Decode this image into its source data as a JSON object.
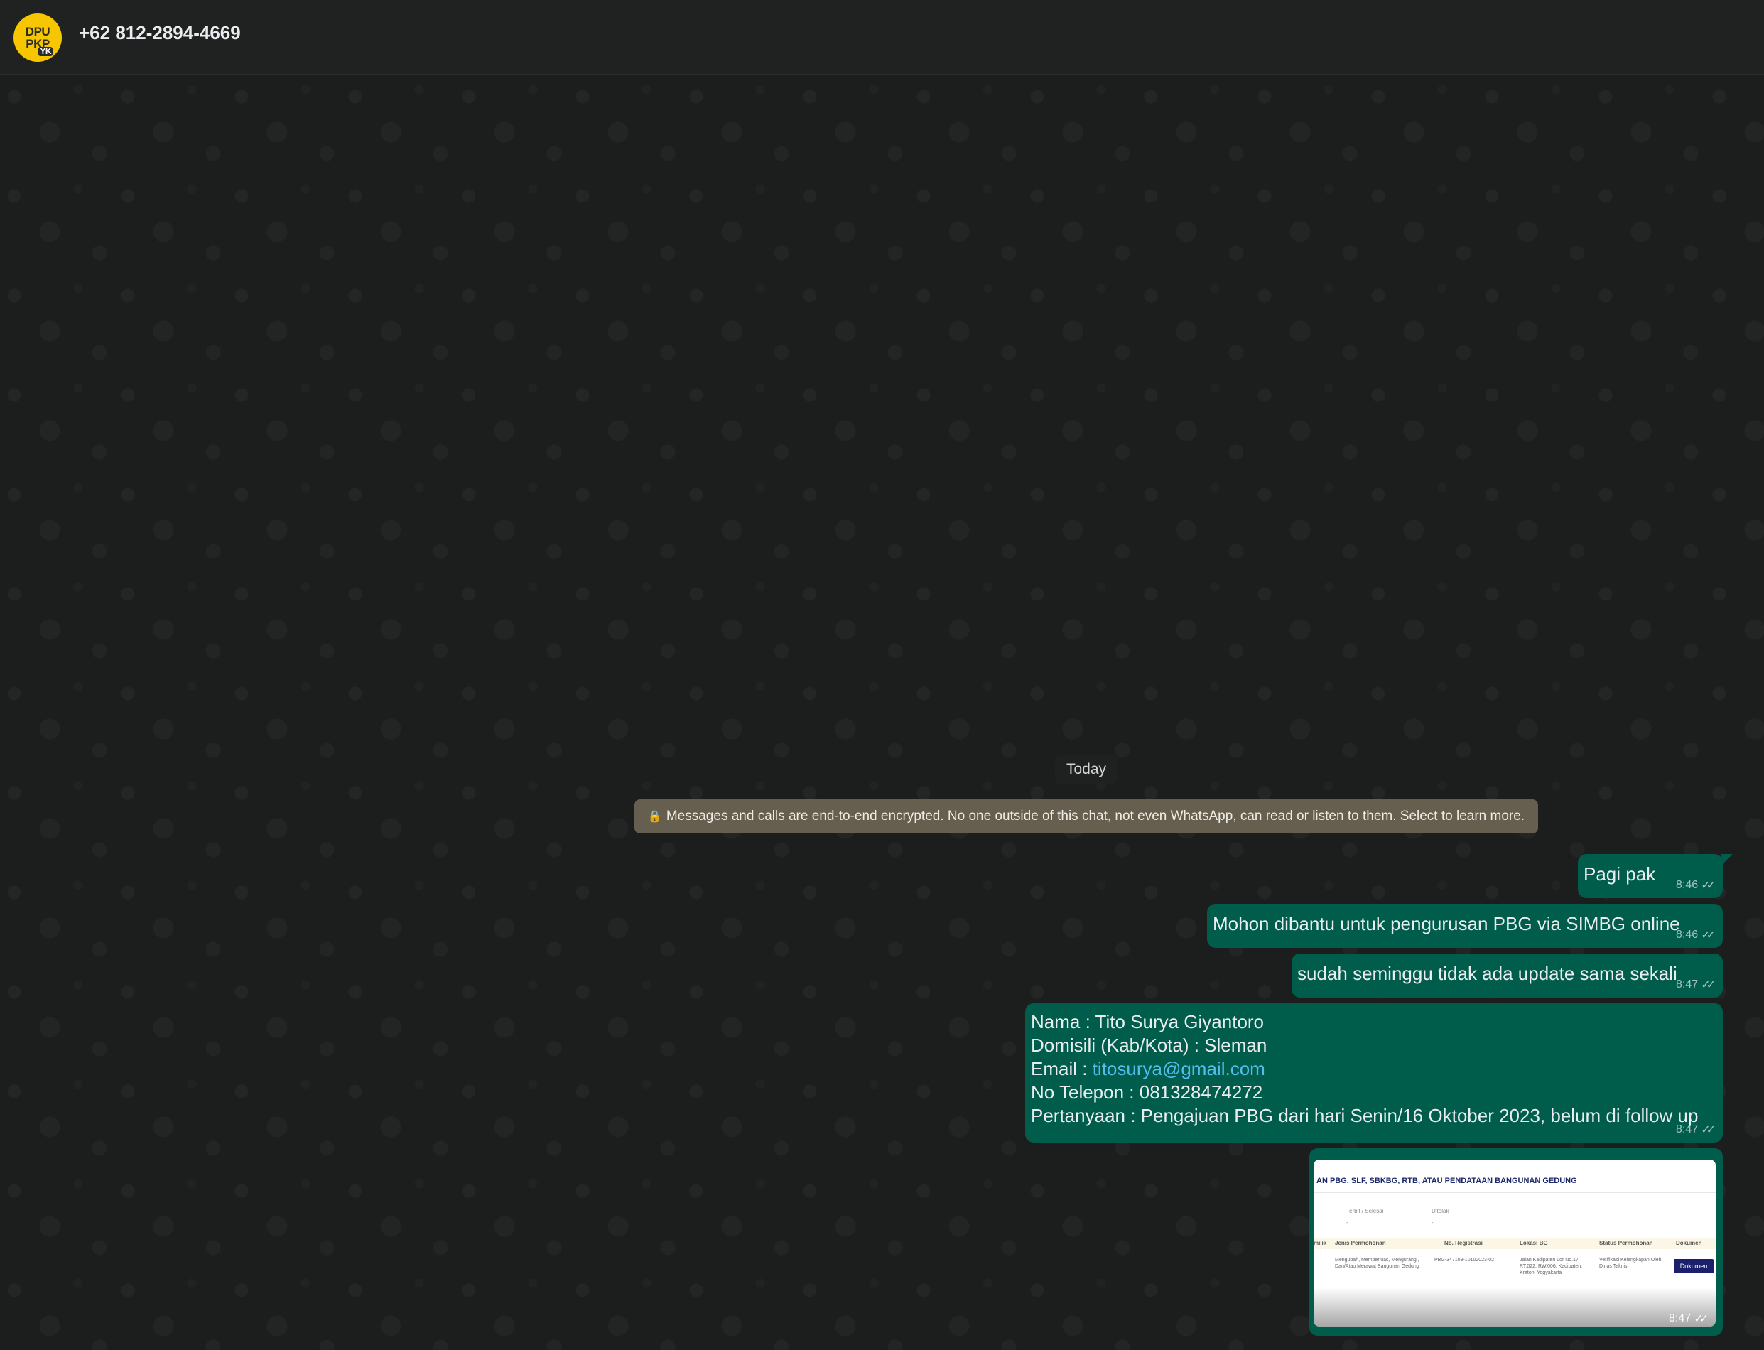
{
  "header": {
    "avatar_text_top": "DPU",
    "avatar_text_bottom": "PKP",
    "avatar_badge": "YK",
    "contact_name": "+62 812-2894-4669"
  },
  "chat": {
    "date_divider": "Today",
    "encryption_notice": "Messages and calls are end-to-end encrypted. No one outside of this chat, not even WhatsApp, can read or listen to them. Select to learn more.",
    "messages": [
      {
        "text": "Pagi pak",
        "time": "8:46"
      },
      {
        "text": "Mohon dibantu untuk pengurusan PBG via SIMBG online",
        "time": "8:46"
      },
      {
        "text": "sudah seminggu tidak ada update sama sekali",
        "time": "8:47"
      },
      {
        "lines": {
          "nama": "Nama : Tito Surya Giyantoro",
          "domisili": "Domisili (Kab/Kota) : Sleman",
          "email_label": "Email : ",
          "email_link": "titosurya@gmail.com",
          "telepon": "No Telepon : 081328474272",
          "pertanyaan": "Pertanyaan : Pengajuan PBG dari hari Senin/16 Oktober 2023, belum di follow up"
        },
        "time": "8:47"
      }
    ],
    "image_message": {
      "time": "8:47",
      "doc_title": "AN PBG, SLF, SBKBG, RTB, ATAU PENDATAAN BANGUNAN GEDUNG",
      "filter_labels": [
        "Terbit / Selesai",
        "Ditolak"
      ],
      "filter_values": [
        "-",
        "-"
      ],
      "columns": [
        "milik",
        "Jenis Permohonan",
        "No. Registrasi",
        "Lokasi BG",
        "Status Permohonan",
        "Dokumen"
      ],
      "row": {
        "jenis": "Mengubah, Memperluas, Mengurangi, Dan/Atau Merawat Bangunan Gedung",
        "registrasi": "PBG-347109-10102023-02",
        "lokasi": "Jalan Kadipaten Lor No.17 RT.022, RW.006, Kadipaten, Kraton, Yogyakarta",
        "status": "Verifikasi Kelengkapan Oleh Dinas Teknis",
        "button": "Dokumen"
      }
    }
  },
  "icons": {
    "lock": "lock-icon",
    "read_ticks": "double-check-icon"
  },
  "colors": {
    "outgoing_bubble": "#005c4b",
    "header_bg": "#202121",
    "link": "#53bdeb",
    "notice_bg": "#665f50",
    "avatar_bg": "#f6c600"
  }
}
